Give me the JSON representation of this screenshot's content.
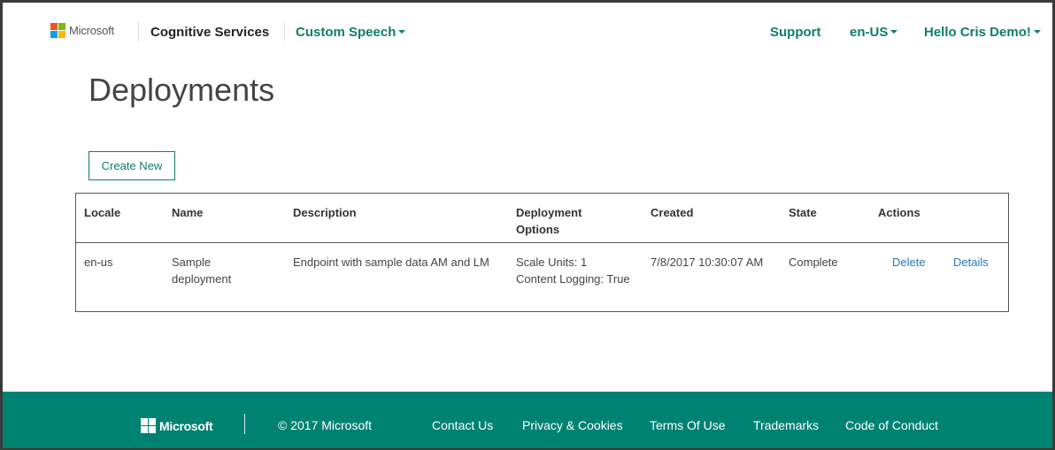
{
  "header": {
    "ms_logo_text": "Microsoft",
    "brand": "Cognitive Services",
    "product_menu": "Custom Speech",
    "support": "Support",
    "locale_menu": "en-US",
    "user_menu": "Hello Cris Demo!"
  },
  "page": {
    "title": "Deployments",
    "create_button": "Create New"
  },
  "table": {
    "columns": [
      "Locale",
      "Name",
      "Description",
      "Deployment Options",
      "Created",
      "State",
      "Actions"
    ],
    "rows": [
      {
        "locale": "en-us",
        "name": "Sample deployment",
        "description": "Endpoint with sample data AM and LM",
        "options_scale_units": "Scale Units: 1",
        "options_content_logging": "Content Logging: True",
        "created": "7/8/2017 10:30:07 AM",
        "state": "Complete",
        "action_delete": "Delete",
        "action_details": "Details"
      }
    ]
  },
  "footer": {
    "ms_logo_text": "Microsoft",
    "copyright": "© 2017 Microsoft",
    "links": [
      "Contact Us",
      "Privacy & Cookies",
      "Terms Of Use",
      "Trademarks",
      "Code of Conduct"
    ]
  },
  "colors": {
    "accent": "#0e7d69",
    "footer_bg": "#008272",
    "link": "#2a7ab5",
    "ms_red": "#f25022",
    "ms_green": "#7fba00",
    "ms_blue": "#00a4ef",
    "ms_yellow": "#ffb900"
  }
}
